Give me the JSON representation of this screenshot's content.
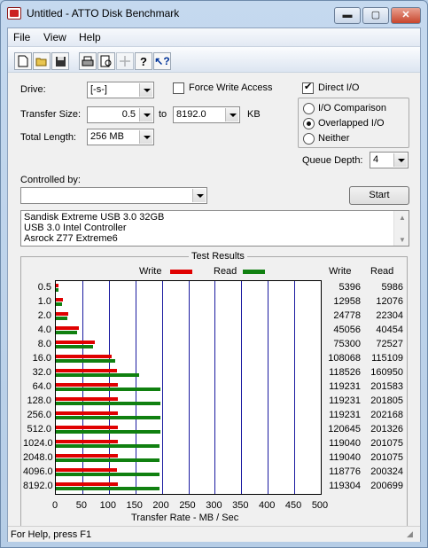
{
  "window": {
    "title": "Untitled - ATTO Disk Benchmark"
  },
  "menu": [
    "File",
    "View",
    "Help"
  ],
  "toolbar_icons": [
    "new-file-icon",
    "open-folder-icon",
    "save-icon",
    "print-icon",
    "print-preview-icon",
    "move-icon",
    "help-icon",
    "context-help-icon"
  ],
  "settings": {
    "drive_label": "Drive:",
    "drive_value": "[-s-]",
    "force_write_label": "Force Write Access",
    "force_write_checked": false,
    "direct_io_label": "Direct I/O",
    "direct_io_checked": true,
    "transfer_size_label": "Transfer Size:",
    "transfer_from": "0.5",
    "to_label": "to",
    "transfer_to": "8192.0",
    "kb_label": "KB",
    "total_length_label": "Total Length:",
    "total_length_value": "256 MB",
    "io_options": [
      {
        "label": "I/O Comparison",
        "selected": false
      },
      {
        "label": "Overlapped I/O",
        "selected": true
      },
      {
        "label": "Neither",
        "selected": false
      }
    ],
    "queue_depth_label": "Queue Depth:",
    "queue_depth_value": "4",
    "controlled_by_label": "Controlled by:",
    "controlled_by_value": "",
    "start_label": "Start"
  },
  "description": [
    "Sandisk Extreme USB 3.0 32GB",
    "USB 3.0 Intel Controller",
    "Asrock Z77 Extreme6"
  ],
  "results": {
    "title": "Test Results",
    "legend_write": "Write",
    "legend_read": "Read",
    "col_write": "Write",
    "col_read": "Read",
    "xlabel": "Transfer Rate - MB / Sec"
  },
  "colors": {
    "write": "#e00000",
    "read": "#108010",
    "grid": "#1a1aa0"
  },
  "chart_data": {
    "type": "bar",
    "orientation": "horizontal",
    "categories": [
      "0.5",
      "1.0",
      "2.0",
      "4.0",
      "8.0",
      "16.0",
      "32.0",
      "64.0",
      "128.0",
      "256.0",
      "512.0",
      "1024.0",
      "2048.0",
      "4096.0",
      "8192.0"
    ],
    "series": [
      {
        "name": "Write",
        "values": [
          5396,
          12958,
          24778,
          45056,
          75300,
          108068,
          118526,
          119231,
          119231,
          119231,
          120645,
          119040,
          119040,
          118776,
          119304
        ]
      },
      {
        "name": "Read",
        "values": [
          5986,
          12076,
          22304,
          40454,
          72527,
          115109,
          160950,
          201583,
          201805,
          202168,
          201326,
          201075,
          201075,
          200324,
          200699
        ]
      }
    ],
    "xticks": [
      0,
      50,
      100,
      150,
      200,
      250,
      300,
      350,
      400,
      450,
      500
    ],
    "xlim": [
      0,
      500
    ],
    "xlabel": "Transfer Rate - MB / Sec",
    "grid": true
  },
  "status": "For Help, press F1"
}
